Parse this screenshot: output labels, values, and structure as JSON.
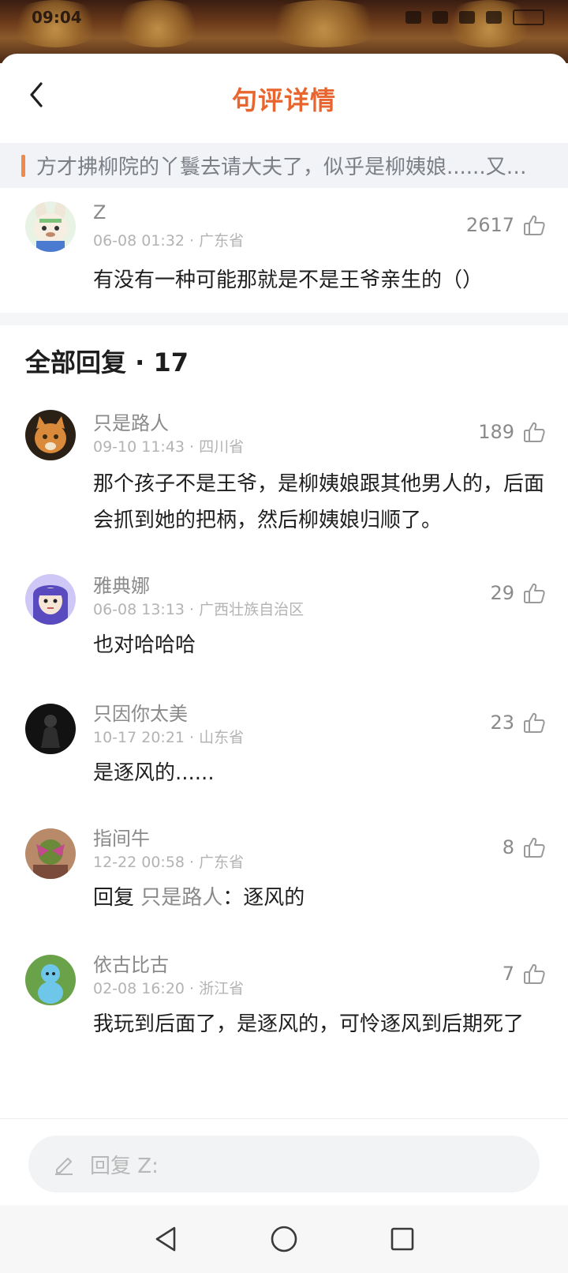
{
  "status_bar": {
    "time": "09:04"
  },
  "header": {
    "title": "句评详情",
    "back_icon": "chevron-left-icon"
  },
  "quote": {
    "text": "方才拂柳院的丫鬟去请大夫了，似乎是柳姨娘......又…"
  },
  "main_comment": {
    "name": "Z",
    "meta": "06-08 01:32 · 广东省",
    "likes": "2617",
    "text": "有没有一种可能那就是不是王爷亲生的（）"
  },
  "replies_header": "全部回复 · 17",
  "replies": [
    {
      "name": "只是路人",
      "meta": "09-10 11:43 · 四川省",
      "likes": "189",
      "text": "那个孩子不是王爷，是柳姨娘跟其他男人的，后面会抓到她的把柄，然后柳姨娘归顺了。"
    },
    {
      "name": "雅典娜",
      "meta": "06-08 13:13 · 广西壮族自治区",
      "likes": "29",
      "text": "也对哈哈哈"
    },
    {
      "name": "只因你太美",
      "meta": "10-17 20:21 · 山东省",
      "likes": "23",
      "text": "是逐风的......"
    },
    {
      "name": "指间牛",
      "meta": "12-22 00:58 · 广东省",
      "likes": "8",
      "text_prefix": "回复 ",
      "text_mention": "只是路人",
      "text_suffix": "：逐风的"
    },
    {
      "name": "依古比古",
      "meta": "02-08 16:20 · 浙江省",
      "likes": "7",
      "text": "我玩到后面了，是逐风的，可怜逐风到后期死了"
    }
  ],
  "reply_input": {
    "placeholder": "回复 Z:",
    "icon": "pencil-icon"
  },
  "nav": {
    "back_icon": "triangle-back-icon",
    "home_icon": "circle-home-icon",
    "recent_icon": "square-recents-icon"
  },
  "colors": {
    "accent": "#e8652f",
    "quote_mark": "#f08a4c",
    "muted_text": "#8a8a8a"
  }
}
